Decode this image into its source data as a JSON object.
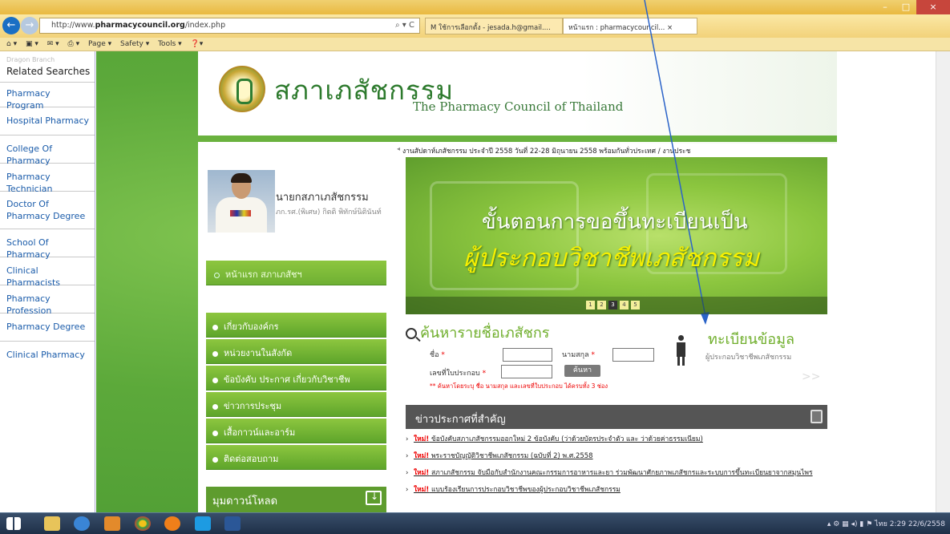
{
  "browser": {
    "url_prefix": "http://www.",
    "url_domain": "pharmacycouncil.org",
    "url_path": "/index.php",
    "url_tools": "⌕ ▾ C",
    "tab1": "M ใช้การเลือกตั้ง - jesada.h@gmail....",
    "tab2": "หน้าแรก : pharmacycouncil... ×",
    "cmd": [
      "Page ▾",
      "Safety ▾",
      "Tools ▾"
    ],
    "win_min": "–",
    "win_max": "□",
    "win_close": "×"
  },
  "sidebar": {
    "dragon": "Dragon Branch",
    "heading": "Related Searches",
    "items": [
      "Pharmacy Program",
      "Hospital Pharmacy",
      "College Of Pharmacy",
      "Pharmacy Technician",
      "Doctor Of Pharmacy Degree",
      "School Of Pharmacy",
      "Clinical Pharmacists",
      "Pharmacy Profession",
      "Pharmacy Degree",
      "Clinical Pharmacy"
    ]
  },
  "site": {
    "brand_th": "สภาเภสัชกรรม",
    "brand_en": "The Pharmacy Council of Thailand",
    "ticker": "งานสัปดาห์เภสัชกรรม ประจำปี 2558 วันที่ 22-28 มิถุนายน 2558 พร้อมกันทั่วประเทศ / งานประช",
    "president_title": "นายกสภาเภสัชกรรม",
    "president_name": "ภก.รศ.(พิเศษ) กิตติ พิทักษ์นิตินันท์",
    "home_btn": "หน้าแรก สภาเภสัชฯ",
    "menu": [
      "เกี่ยวกับองค์กร",
      "หน่วยงานในสังกัด",
      "ข้อบังคับ ประกาศ เกี่ยวกับวิชาชีพ",
      "ข่าวการประชุม",
      "เสื้อกาวน์และอาร์ม",
      "ติดต่อสอบถาม"
    ],
    "downloads": "มุมดาวน์โหลด",
    "banner_line1": "ขั้นตอนการขอขึ้นทะเบียนเป็น",
    "banner_line2": "ผู้ประกอบวิชาชีพเภสัชกรรม",
    "banner_pages": [
      "1",
      "2",
      "3",
      "4",
      "5"
    ],
    "search_title": "ค้นหารายชื่อเภสัชกร",
    "lbl_name": "ชื่อ",
    "lbl_surname": "นามสกุล",
    "lbl_license": "เลขที่ใบประกอบ",
    "req": "*",
    "search_btn": "ค้นหา",
    "search_note": "** ค้นหาโดยระบุ ชื่อ นามสกุล และเลขที่ใบประกอบ ได้ครบทั้ง 3 ช่อง",
    "reg_title": "ทะเบียนข้อมูล",
    "reg_sub": "ผู้ประกอบวิชาชีพเภสัชกรรม",
    "reg_arrow": ">>",
    "news_title": "ข่าวประกาศที่สำคัญ",
    "new_tag": "ใหม่!",
    "news": [
      "ข้อบังคับสภาเภสัชกรรมออกใหม่ 2 ข้อบังคับ (ว่าด้วยบัตรประจำตัว และ ว่าด้วยค่าธรรมเนียม)",
      "พระราชบัญญัติวิชาชีพเภสัชกรรม (ฉบับที่ 2) พ.ศ.2558",
      "สภาเภสัชกรรม จับมือกับสำนักงานคณะกรรมการอาหารและยา ร่วมพัฒนาศักยภาพเภสัชกรและระบบการขึ้นทะเบียนยาจากสมุนไพร",
      "แบบร้องเรียนการประกอบวิชาชีพของผู้ประกอบวิชาชีพเภสัชกรรม"
    ]
  },
  "taskbar": {
    "time": "2:29",
    "date": "22/6/2558",
    "lang": "ไทย"
  },
  "colors": {
    "site_green": "#6ab23e",
    "brand_green": "#2d7a2d",
    "new_red": "#e00000"
  }
}
